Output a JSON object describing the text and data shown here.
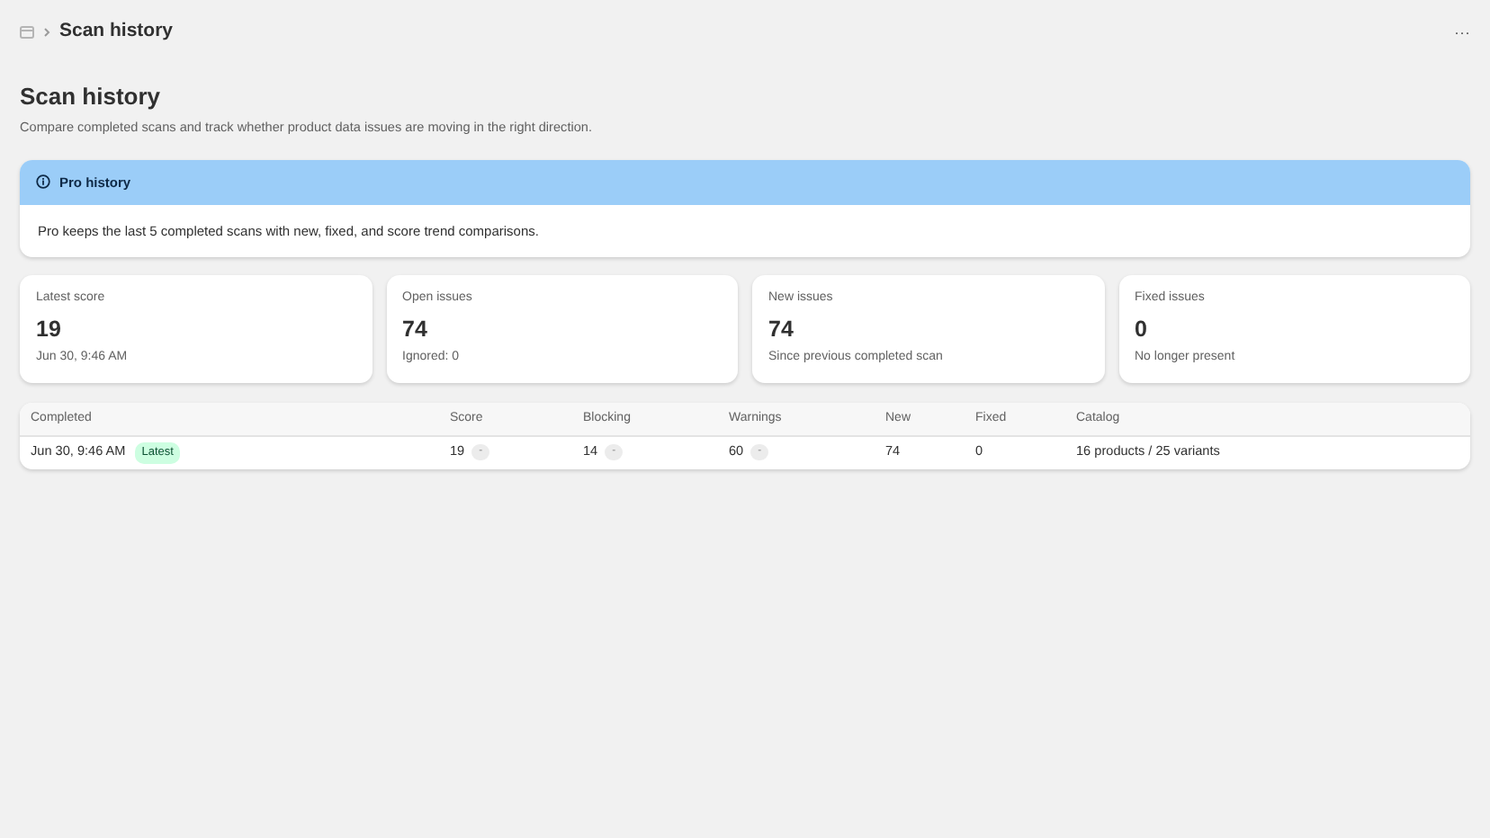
{
  "topbar": {
    "breadcrumb": "Scan history",
    "more": "···"
  },
  "header": {
    "title": "Scan history",
    "subtitle": "Compare completed scans and track whether product data issues are moving in the right direction."
  },
  "banner": {
    "title": "Pro history",
    "body": "Pro keeps the last 5 completed scans with new, fixed, and score trend comparisons."
  },
  "stats": [
    {
      "label": "Latest score",
      "value": "19",
      "note": "Jun 30, 9:46 AM"
    },
    {
      "label": "Open issues",
      "value": "74",
      "note": "Ignored: 0"
    },
    {
      "label": "New issues",
      "value": "74",
      "note": "Since previous completed scan"
    },
    {
      "label": "Fixed issues",
      "value": "0",
      "note": "No longer present"
    }
  ],
  "table": {
    "columns": [
      "Completed",
      "Score",
      "Blocking",
      "Warnings",
      "New",
      "Fixed",
      "Catalog"
    ],
    "rows": [
      {
        "completed": "Jun 30, 9:46 AM",
        "tag": "Latest",
        "score": "19",
        "score_delta": "-",
        "blocking": "14",
        "blocking_delta": "-",
        "warnings": "60",
        "warnings_delta": "-",
        "new": "74",
        "fixed": "0",
        "catalog": "16 products / 25 variants"
      }
    ]
  }
}
